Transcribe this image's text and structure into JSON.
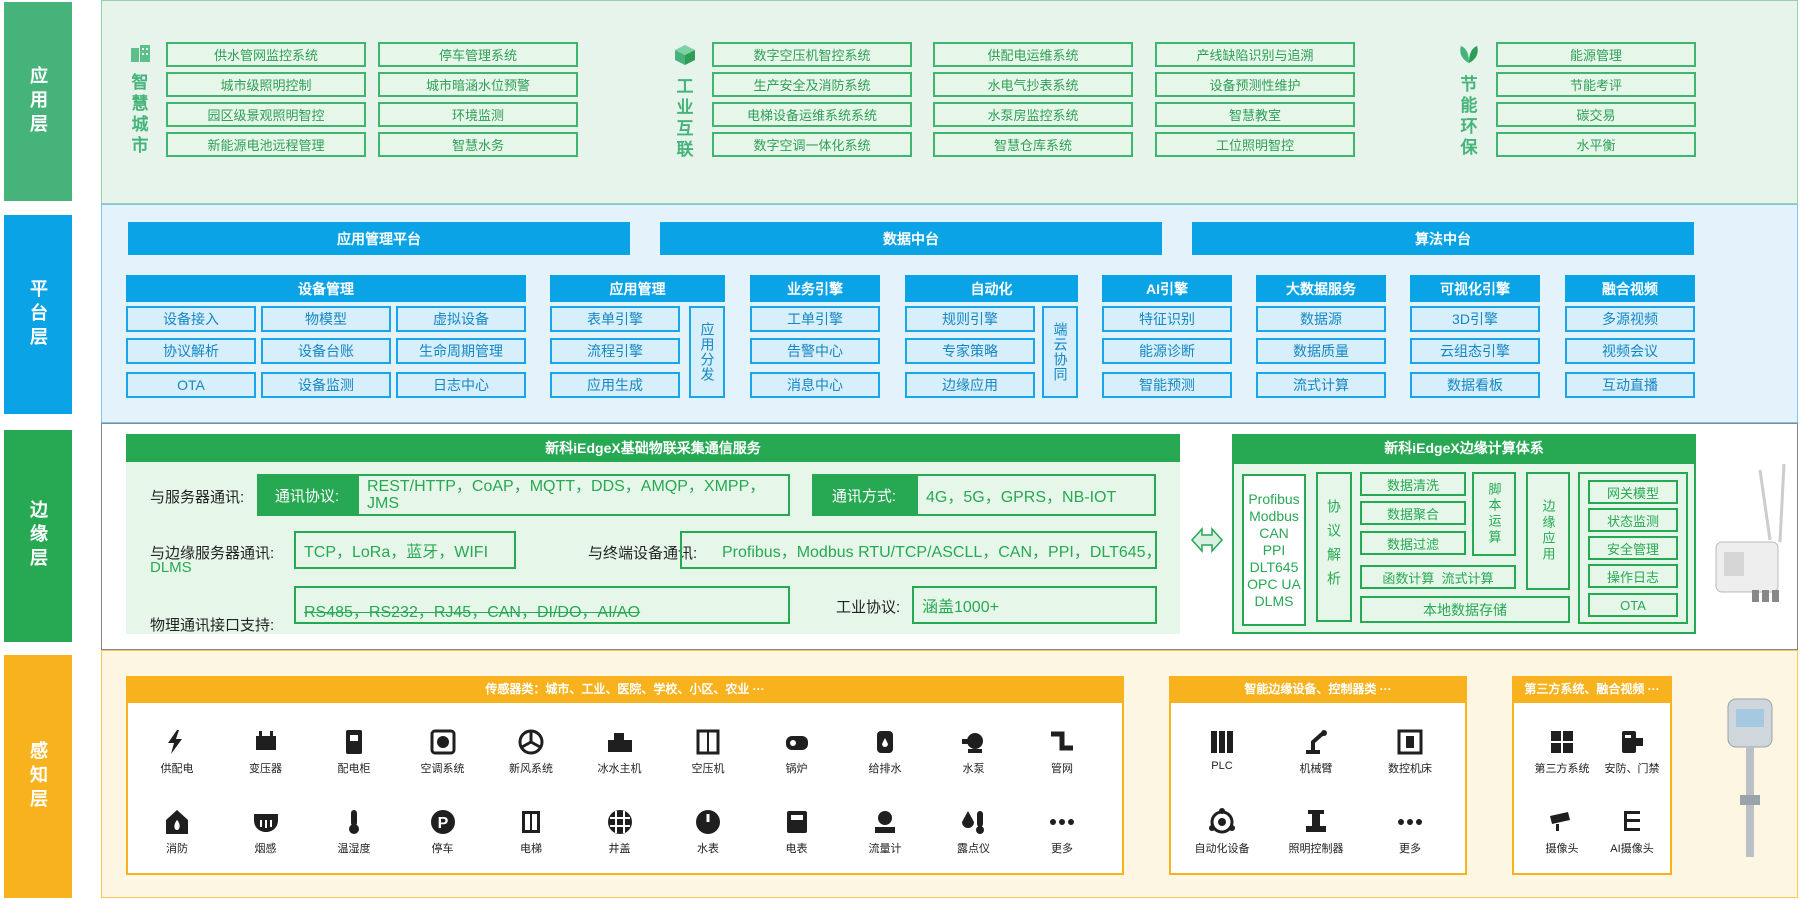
{
  "layers": {
    "app": "应用层",
    "platform": "平台层",
    "edge": "边缘层",
    "sense": "感知层"
  },
  "app": {
    "smart_city": {
      "title": "智慧城市",
      "icon": "building-icon",
      "col1": [
        "供水管网监控系统",
        "城市级照明控制",
        "园区级景观照明智控",
        "新能源电池远程管理"
      ],
      "col2": [
        "停车管理系统",
        "城市暗涵水位预警",
        "环境监测",
        "智慧水务"
      ]
    },
    "industrial": {
      "title": "工业互联",
      "icon": "cube-icon",
      "col1": [
        "数字空压机智控系统",
        "生产安全及消防系统",
        "电梯设备运维系统系统",
        "数字空调一体化系统"
      ],
      "col2": [
        "供配电运维系统",
        "水电气抄表系统",
        "水泵房监控系统",
        "智慧仓库系统"
      ],
      "col3": [
        "产线缺陷识别与追溯",
        "设备预测性维护",
        "智慧教室",
        "工位照明智控"
      ]
    },
    "eco": {
      "title": "节能环保",
      "icon": "leaf-icon",
      "items": [
        "能源管理",
        "节能考评",
        "碳交易",
        "水平衡"
      ]
    }
  },
  "platform": {
    "bars": [
      "应用管理平台",
      "数据中台",
      "算法中台"
    ],
    "device_mgmt": {
      "title": "设备管理",
      "items": [
        "设备接入",
        "物模型",
        "虚拟设备",
        "协议解析",
        "设备台账",
        "生命周期管理",
        "OTA",
        "设备监测",
        "日志中心"
      ]
    },
    "app_mgmt": {
      "title": "应用管理",
      "items": [
        "表单引擎",
        "流程引擎",
        "应用生成"
      ],
      "side": "应用分发"
    },
    "biz_engine": {
      "title": "业务引擎",
      "items": [
        "工单引擎",
        "告警中心",
        "消息中心"
      ]
    },
    "automation": {
      "title": "自动化",
      "items": [
        "规则引擎",
        "专家策略",
        "边缘应用"
      ],
      "side": "端云协同"
    },
    "ai_engine": {
      "title": "AI引擎",
      "items": [
        "特征识别",
        "能源诊断",
        "智能预测"
      ]
    },
    "bigdata": {
      "title": "大数据服务",
      "items": [
        "数据源",
        "数据质量",
        "流式计算"
      ]
    },
    "visual": {
      "title": "可视化引擎",
      "items": [
        "3D引擎",
        "云组态引擎",
        "数据看板"
      ]
    },
    "video": {
      "title": "融合视频",
      "items": [
        "多源视频",
        "视频会议",
        "互动直播"
      ]
    }
  },
  "edge": {
    "comm_title": "新科iEdgeX基础物联采集通信服务",
    "server_label": "与服务器通讯:",
    "protocol_tag": "通讯协议:",
    "protocol_value": "REST/HTTP，CoAP，MQTT，DDS，AMQP，XMPP，JMS",
    "method_tag": "通讯方式:",
    "method_value": "4G，5G，GPRS，NB-IOT",
    "edge_server_label": "与边缘服务器通讯:",
    "edge_server_value": "TCP，LoRa，蓝牙，WIFI",
    "edge_server_wrap": "DLMS",
    "terminal_label": "与终端设备通讯:",
    "terminal_value": "Profibus，Modbus RTU/TCP/ASCLL，CAN，PPI，DLT645，",
    "physical_label": "物理通讯接口支持:",
    "physical_value": "RS485，RS232，RJ45，CAN，DI/DO，AI/AO",
    "industrial_label": "工业协议:",
    "industrial_value": "涵盖1000+",
    "compute_title": "新科iEdgeX边缘计算体系",
    "protocols": [
      "Profibus",
      "Modbus",
      "CAN",
      "PPI",
      "DLT645",
      "OPC UA",
      "DLMS"
    ],
    "parse": "协议解析",
    "data_ops": [
      "数据清洗",
      "数据聚合",
      "数据过滤"
    ],
    "script": "脚本运算",
    "func_calc": "函数计算  流式计算",
    "local_storage": "本地数据存储",
    "edge_app": "边缘应用",
    "gateway": [
      "网关模型",
      "状态监测",
      "安全管理",
      "操作日志",
      "OTA"
    ]
  },
  "sense": {
    "sensor_title": "传感器类：城市、工业、医院、学校、小区、农业 ···",
    "sensors": [
      {
        "label": "供配电",
        "icon": "lightning-icon"
      },
      {
        "label": "变压器",
        "icon": "transformer-icon"
      },
      {
        "label": "配电柜",
        "icon": "cabinet-icon"
      },
      {
        "label": "空调系统",
        "icon": "fan-icon"
      },
      {
        "label": "新风系统",
        "icon": "ventilation-icon"
      },
      {
        "label": "冰水主机",
        "icon": "chiller-icon"
      },
      {
        "label": "空压机",
        "icon": "compressor-icon"
      },
      {
        "label": "锅炉",
        "icon": "boiler-icon"
      },
      {
        "label": "给排水",
        "icon": "water-tank-icon"
      },
      {
        "label": "水泵",
        "icon": "pump-icon"
      },
      {
        "label": "管网",
        "icon": "pipe-icon"
      },
      {
        "label": "消防",
        "icon": "fire-icon"
      },
      {
        "label": "烟感",
        "icon": "smoke-detector-icon"
      },
      {
        "label": "温湿度",
        "icon": "thermometer-icon"
      },
      {
        "label": "停车",
        "icon": "parking-icon"
      },
      {
        "label": "电梯",
        "icon": "elevator-icon"
      },
      {
        "label": "井盖",
        "icon": "manhole-icon"
      },
      {
        "label": "水表",
        "icon": "water-meter-icon"
      },
      {
        "label": "电表",
        "icon": "electric-meter-icon"
      },
      {
        "label": "流量计",
        "icon": "flowmeter-icon"
      },
      {
        "label": "露点仪",
        "icon": "dewpoint-icon"
      },
      {
        "label": "更多",
        "icon": "more-icon"
      }
    ],
    "smart_title": "智能边缘设备、控制器类 ···",
    "smart": [
      {
        "label": "PLC",
        "icon": "plc-icon"
      },
      {
        "label": "机械臂",
        "icon": "robot-arm-icon"
      },
      {
        "label": "数控机床",
        "icon": "cnc-icon"
      },
      {
        "label": "自动化设备",
        "icon": "automation-icon"
      },
      {
        "label": "照明控制器",
        "icon": "lighting-controller-icon"
      },
      {
        "label": "更多",
        "icon": "more-icon"
      }
    ],
    "third_title": "第三方系统、融合视频 ···",
    "third": [
      {
        "label": "第三方系统",
        "icon": "grid-icon"
      },
      {
        "label": "安防、门禁",
        "icon": "access-control-icon"
      },
      {
        "label": "摄像头",
        "icon": "camera-icon"
      },
      {
        "label": "AI摄像头",
        "icon": "ai-camera-icon"
      }
    ]
  },
  "colors": {
    "app_green": "#46b47a",
    "platform_blue": "#0aa3e6",
    "edge_green": "#27a853",
    "sense_orange": "#f7b21d"
  }
}
